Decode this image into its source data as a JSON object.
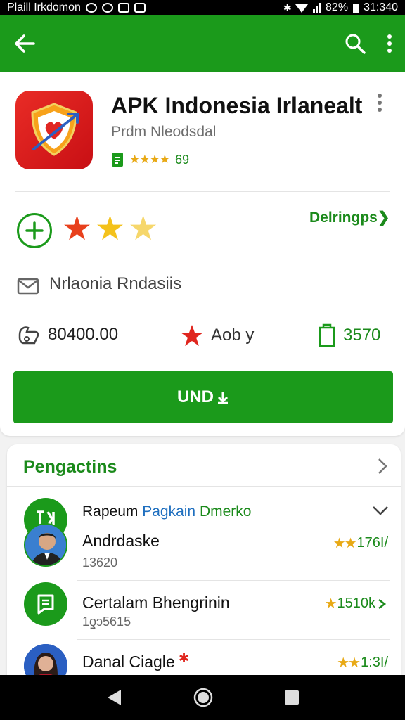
{
  "status_bar": {
    "carrier": "Plaill Irkdomon",
    "battery": "82%",
    "time": "31:340"
  },
  "app": {
    "title": "APK Indonesia Irlanealt",
    "developer": "Prdm Nleodsdal",
    "meta_stars": "★★★★",
    "meta_count": "69"
  },
  "actions": {
    "details_link": "Delringps❯",
    "rating_stars": [
      "★",
      "★",
      "★"
    ],
    "rating_colors": [
      "#e8401c",
      "#f4c21b",
      "#f6d76b"
    ]
  },
  "section_label": "Nrlaonia Rndasiis",
  "stats": {
    "downloads": "80400.00",
    "rating": "Aob y",
    "size": "3570"
  },
  "install_button": "UND",
  "list": {
    "title": "Pengactins",
    "featured": {
      "part1": "Rapeum ",
      "part2": "Pagkain ",
      "part3": "Dmerko"
    },
    "items": [
      {
        "name": "Andrdaske",
        "sub": "13620",
        "rating": "176I/",
        "stars": "★★"
      },
      {
        "name": "Certalam Bhengrinin",
        "sub": "1ƍɔ5615",
        "rating": "1510k",
        "stars": "★"
      },
      {
        "name": "Danal Ciagle",
        "sub": "",
        "rating": "1:3I/",
        "stars": "★★"
      }
    ]
  },
  "colors": {
    "brand_green": "#1b9a1b",
    "star_yellow": "#e8a915",
    "link_blue": "#1f6fbf"
  }
}
